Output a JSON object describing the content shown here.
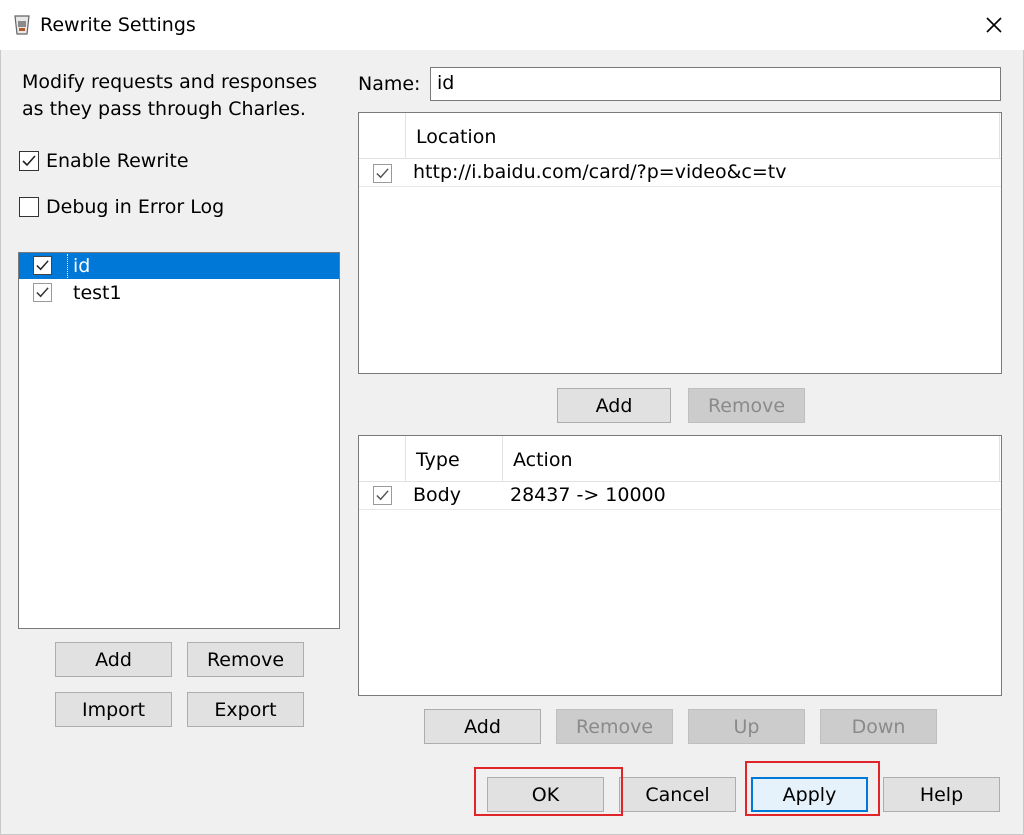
{
  "window": {
    "title": "Rewrite Settings",
    "close_glyph": "✕"
  },
  "intro": {
    "line1": "Modify requests and responses",
    "line2": "as they pass through Charles."
  },
  "options": {
    "enable_rewrite": "Enable Rewrite",
    "debug_log": "Debug in Error Log"
  },
  "sets": {
    "items": [
      {
        "label": "id",
        "checked": true,
        "selected": true
      },
      {
        "label": "test1",
        "checked": true,
        "selected": false
      }
    ],
    "buttons": {
      "add": "Add",
      "remove": "Remove",
      "import": "Import",
      "export": "Export"
    }
  },
  "name": {
    "label": "Name:",
    "value": "id"
  },
  "locations": {
    "header": "Location",
    "rows": [
      {
        "checked": true,
        "url": "http://i.baidu.com/card/?p=video&c=tv"
      }
    ],
    "buttons": {
      "add": "Add",
      "remove": "Remove"
    }
  },
  "rules": {
    "headers": {
      "type": "Type",
      "action": "Action"
    },
    "rows": [
      {
        "checked": true,
        "type": "Body",
        "action": "28437 -> 10000"
      }
    ],
    "buttons": {
      "add": "Add",
      "remove": "Remove",
      "up": "Up",
      "down": "Down"
    }
  },
  "footer": {
    "ok": "OK",
    "cancel": "Cancel",
    "apply": "Apply",
    "help": "Help"
  },
  "colors": {
    "selection": "#0078d7",
    "highlight_box": "#e0242a",
    "dialog_bg": "#f0f0f0"
  }
}
